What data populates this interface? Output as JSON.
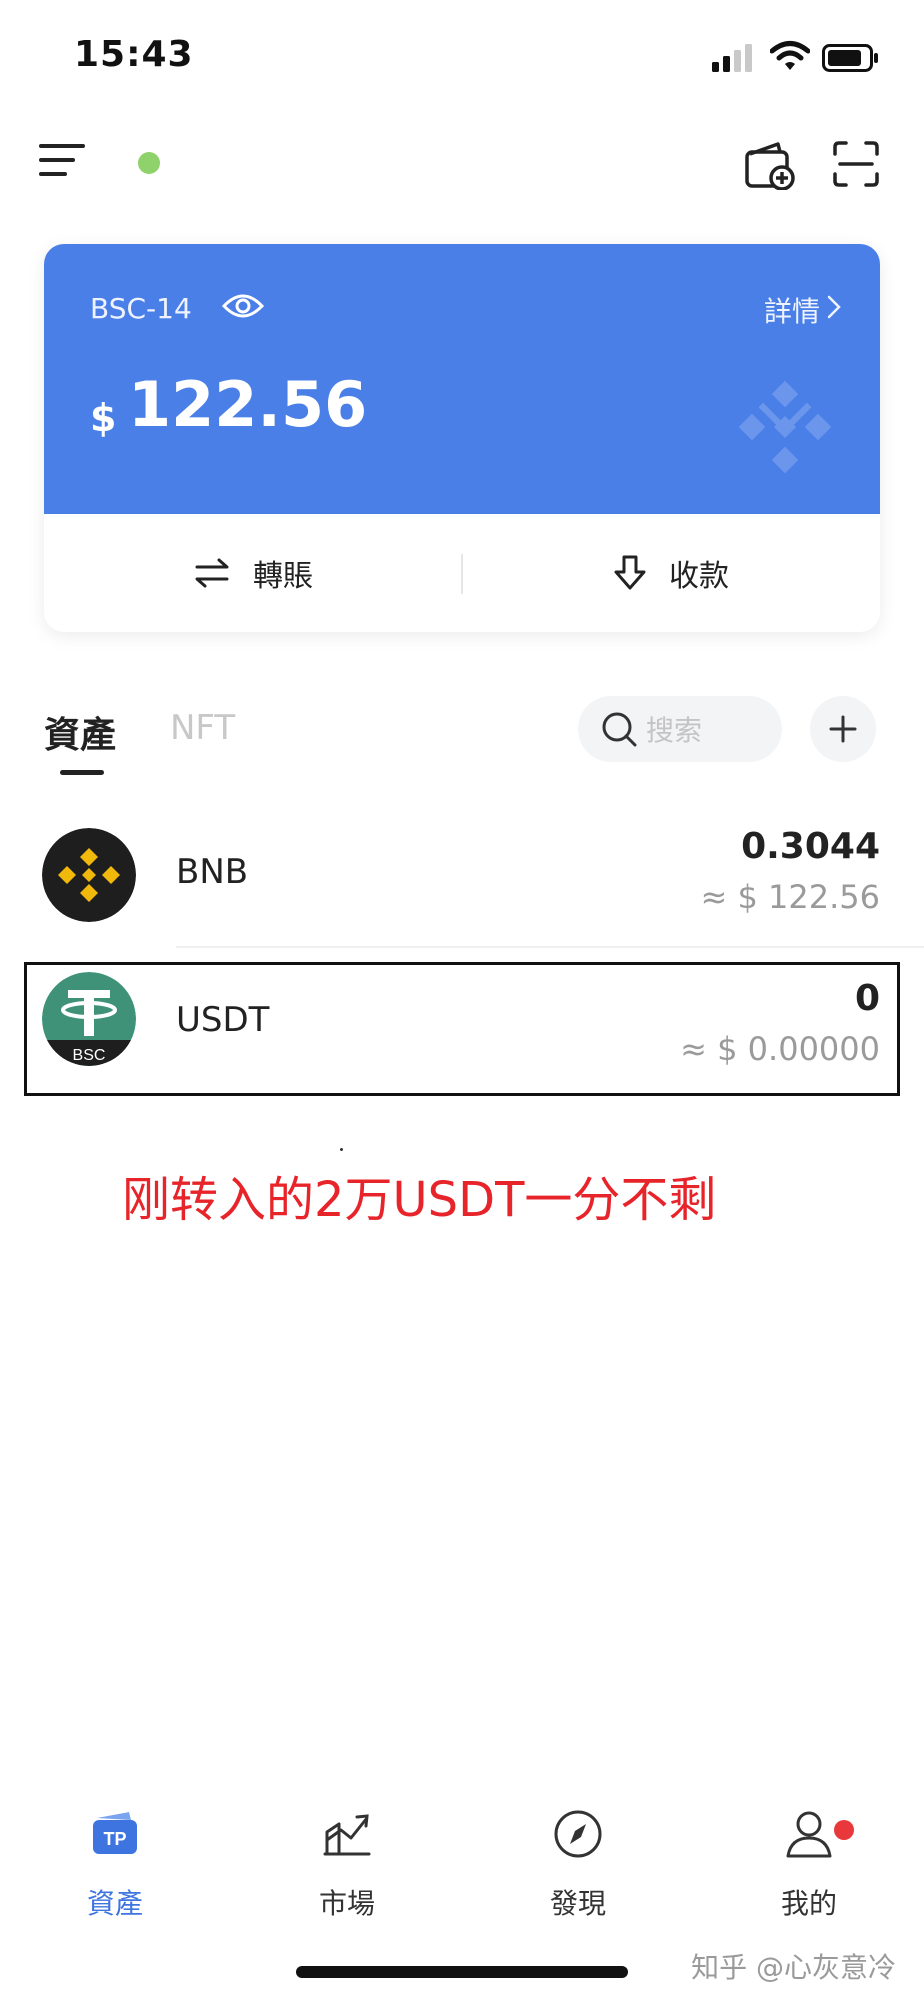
{
  "status_bar": {
    "time": "15:43"
  },
  "header": {
    "icons": [
      "menu-icon",
      "add-wallet-icon",
      "scan-icon"
    ],
    "online_color": "#8fd16a"
  },
  "wallet_card": {
    "wallet_name": "BSC-14",
    "details_label": "詳情",
    "currency_symbol": "$",
    "balance": "122.56",
    "transfer_label": "轉賬",
    "receive_label": "收款",
    "card_color": "#4a7fe8"
  },
  "tabs": {
    "assets_label": "資產",
    "nft_label": "NFT",
    "search_placeholder": "搜索"
  },
  "tokens": [
    {
      "name": "BNB",
      "amount": "0.3044",
      "value": "≈ $ 122.56"
    },
    {
      "name": "USDT",
      "amount": "0",
      "value": "≈ $ 0.00000",
      "badge": "BSC"
    }
  ],
  "annotation": "刚转入的2万USDT一分不剩",
  "bottom_nav": [
    {
      "label": "資產",
      "icon": "tp-wallet-icon",
      "active": true
    },
    {
      "label": "市場",
      "icon": "chart-icon"
    },
    {
      "label": "發現",
      "icon": "compass-icon"
    },
    {
      "label": "我的",
      "icon": "user-icon"
    }
  ],
  "watermark": "知乎 @心灰意冷",
  "accent_color": "#3d74e0",
  "annotation_color": "#e8242b"
}
